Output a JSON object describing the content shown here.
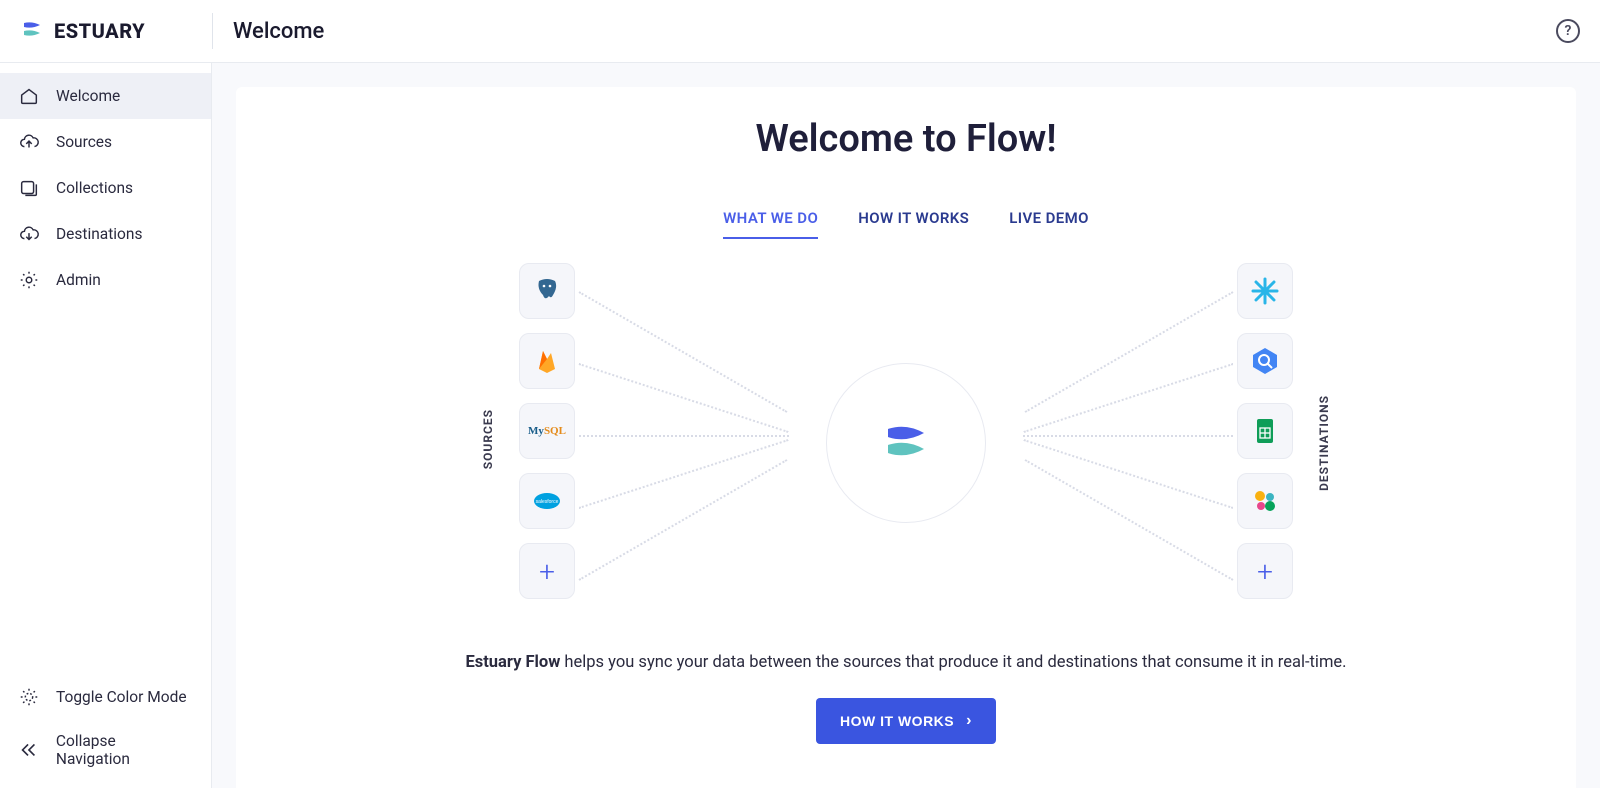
{
  "brand": {
    "name": "ESTUARY"
  },
  "header": {
    "title": "Welcome"
  },
  "sidebar": {
    "items": [
      {
        "label": "Welcome",
        "icon": "home"
      },
      {
        "label": "Sources",
        "icon": "cloud-up"
      },
      {
        "label": "Collections",
        "icon": "collection"
      },
      {
        "label": "Destinations",
        "icon": "cloud-down"
      },
      {
        "label": "Admin",
        "icon": "gear"
      }
    ],
    "bottom": [
      {
        "label": "Toggle Color Mode",
        "icon": "sun"
      },
      {
        "label": "Collapse Navigation",
        "icon": "chevrons-left"
      }
    ]
  },
  "main": {
    "title": "Welcome to Flow!",
    "tabs": [
      {
        "label": "WHAT WE DO",
        "active": true
      },
      {
        "label": "HOW IT WORKS",
        "active": false
      },
      {
        "label": "LIVE DEMO",
        "active": false
      }
    ],
    "diagram": {
      "left_label": "SOURCES",
      "right_label": "DESTINATIONS",
      "sources": [
        "postgresql",
        "firebase",
        "mysql",
        "salesforce",
        "add"
      ],
      "destinations": [
        "snowflake",
        "bigquery",
        "google-sheets",
        "elastic",
        "add"
      ]
    },
    "description_bold": "Estuary Flow",
    "description_rest": " helps you sync your data between the sources that produce it and destinations that consume it in real-time.",
    "cta_label": "HOW IT WORKS"
  }
}
